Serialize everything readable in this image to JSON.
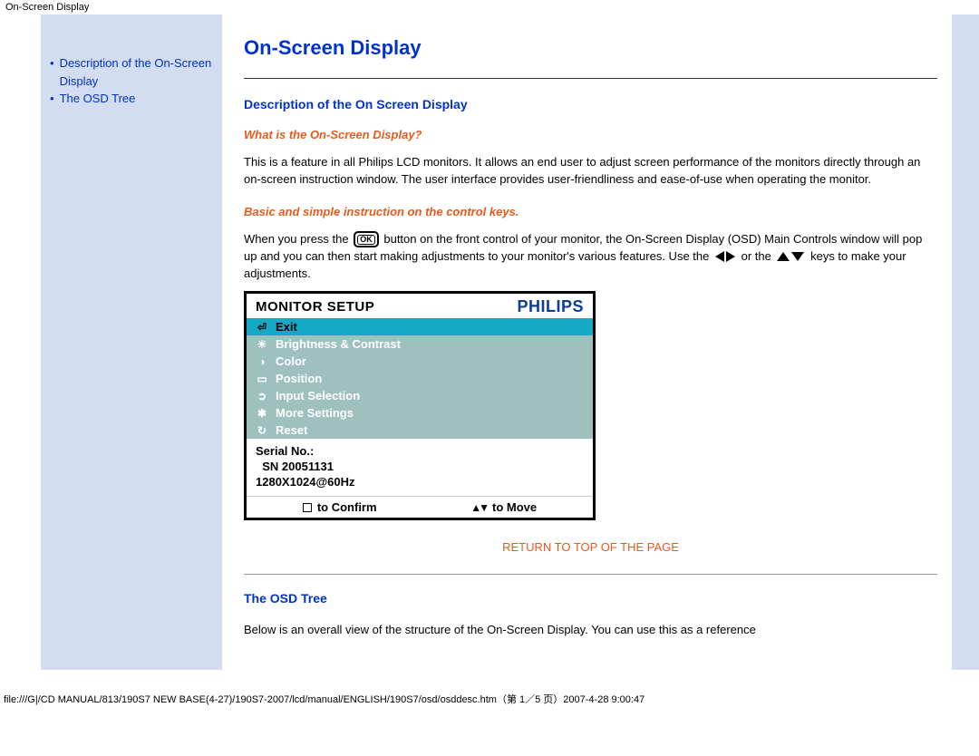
{
  "window_title": "On-Screen Display",
  "sidebar": {
    "items": [
      {
        "label": "Description of the On-Screen Display"
      },
      {
        "label": "The OSD Tree"
      }
    ]
  },
  "main": {
    "page_title": "On-Screen Display",
    "section1_heading": "Description of the On Screen Display",
    "sub1_heading": "What is the On-Screen Display?",
    "para1": "This is a feature in all Philips LCD monitors. It allows an end user to adjust screen performance of the monitors directly through an on-screen instruction window. The user interface provides user-friendliness and ease-of-use when operating the monitor.",
    "sub2_heading": "Basic and simple instruction on the control keys.",
    "para2_a": "When you press the ",
    "para2_b": " button on the front control of your monitor, the On-Screen Display (OSD) Main Controls window will pop up and you can then start making adjustments to your monitor's various features. Use the ",
    "para2_c": " or the ",
    "para2_d": " keys to make your adjustments.",
    "return_label": "RETURN TO TOP OF THE PAGE",
    "section2_heading": "The OSD Tree",
    "para3": "Below is an overall view of the structure of the On-Screen Display. You can use this as a reference"
  },
  "osd": {
    "title": "MONITOR SETUP",
    "brand": "PHILIPS",
    "items": [
      {
        "label": "Exit",
        "icon": "⏎",
        "active": true
      },
      {
        "label": "Brightness & Contrast",
        "icon": "☀"
      },
      {
        "label": "Color",
        "icon": "◑"
      },
      {
        "label": "Position",
        "icon": "▭"
      },
      {
        "label": "Input Selection",
        "icon": "➲"
      },
      {
        "label": "More Settings",
        "icon": "✱"
      },
      {
        "label": "Reset",
        "icon": "↻"
      }
    ],
    "info_line1": "Serial No.:",
    "info_line2": "  SN 20051131",
    "info_line3": "1280X1024@60Hz",
    "confirm_label": "to Confirm",
    "move_label": "to Move"
  },
  "footer_path": "file:///G|/CD MANUAL/813/190S7 NEW BASE(4-27)/190S7-2007/lcd/manual/ENGLISH/190S7/osd/osddesc.htm（第 1／5 页）2007-4-28 9:00:47"
}
